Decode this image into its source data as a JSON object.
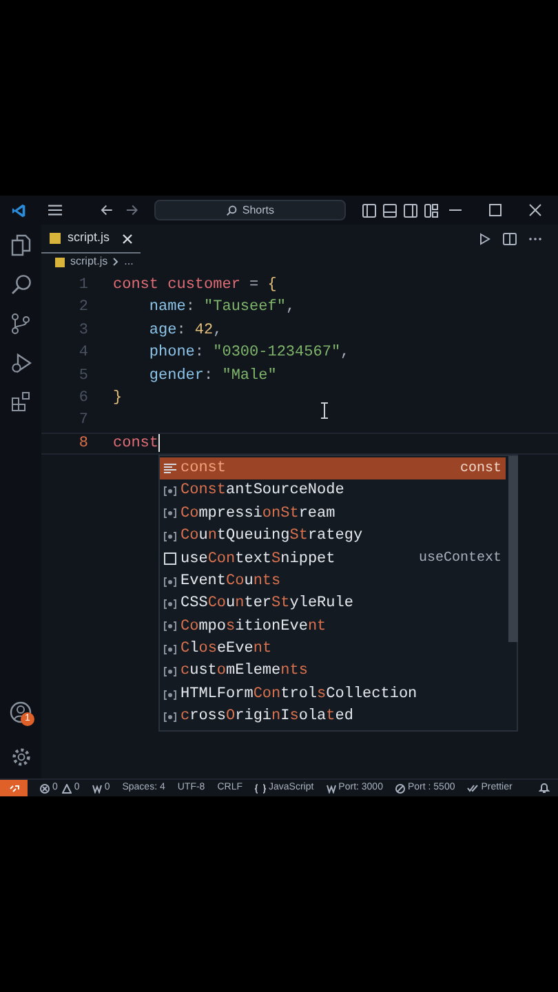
{
  "title_bar": {
    "search": "Shorts"
  },
  "tab": {
    "label": "script.js",
    "selected": true
  },
  "breadcrumb": {
    "file": "script.js",
    "rest": "..."
  },
  "editor": {
    "lines": [
      {
        "number": "1",
        "current": false,
        "tokens": [
          {
            "kind": "keyword",
            "text": "const"
          },
          {
            "kind": "variable",
            "text": " customer"
          },
          {
            "kind": "plain",
            "text": " = "
          },
          {
            "kind": "brace",
            "text": "{"
          }
        ]
      },
      {
        "number": "2",
        "current": false,
        "tokens": [
          {
            "kind": "property",
            "text": "    name"
          },
          {
            "kind": "plain",
            "text": ": "
          },
          {
            "kind": "string",
            "text": "\"Tauseef\""
          },
          {
            "kind": "plain",
            "text": ","
          }
        ]
      },
      {
        "number": "3",
        "current": false,
        "tokens": [
          {
            "kind": "property",
            "text": "    age"
          },
          {
            "kind": "plain",
            "text": ": "
          },
          {
            "kind": "number",
            "text": "42"
          },
          {
            "kind": "plain",
            "text": ","
          }
        ]
      },
      {
        "number": "4",
        "current": false,
        "tokens": [
          {
            "kind": "property",
            "text": "    phone"
          },
          {
            "kind": "plain",
            "text": ": "
          },
          {
            "kind": "string",
            "text": "\"0300-1234567\""
          },
          {
            "kind": "plain",
            "text": ","
          }
        ]
      },
      {
        "number": "5",
        "current": false,
        "tokens": [
          {
            "kind": "property",
            "text": "    gender"
          },
          {
            "kind": "plain",
            "text": ": "
          },
          {
            "kind": "string",
            "text": "\"Male\""
          }
        ]
      },
      {
        "number": "6",
        "current": false,
        "tokens": [
          {
            "kind": "brace",
            "text": "}"
          }
        ]
      },
      {
        "number": "7",
        "current": false
      },
      {
        "number": "8",
        "current": true,
        "tokens": [
          {
            "kind": "keyword",
            "text": "const"
          }
        ]
      }
    ]
  },
  "suggestions": [
    {
      "kind": "keyword",
      "selected": true,
      "parts": [
        {
          "text": "const",
          "match": true
        }
      ],
      "detail": "const"
    },
    {
      "kind": "variable",
      "selected": false,
      "parts": [
        {
          "text": "Const",
          "match": true
        },
        {
          "text": "antSourceNode",
          "match": false
        }
      ]
    },
    {
      "kind": "variable",
      "selected": false,
      "parts": [
        {
          "text": "Co",
          "match": true
        },
        {
          "text": "mpressi",
          "match": false
        },
        {
          "text": "onSt",
          "match": true
        },
        {
          "text": "ream",
          "match": false
        }
      ]
    },
    {
      "kind": "variable",
      "selected": false,
      "parts": [
        {
          "text": "Co",
          "match": true
        },
        {
          "text": "u",
          "match": false
        },
        {
          "text": "n",
          "match": true
        },
        {
          "text": "tQueuing",
          "match": false
        },
        {
          "text": "St",
          "match": true
        },
        {
          "text": "rategy",
          "match": false
        }
      ]
    },
    {
      "kind": "snippet",
      "selected": false,
      "parts": [
        {
          "text": "use",
          "match": false
        },
        {
          "text": "Con",
          "match": true
        },
        {
          "text": "text",
          "match": false
        },
        {
          "text": "S",
          "match": true
        },
        {
          "text": "nippet",
          "match": false
        }
      ],
      "detail": "useContext"
    },
    {
      "kind": "variable",
      "selected": false,
      "parts": [
        {
          "text": "Event",
          "match": false
        },
        {
          "text": "Co",
          "match": true
        },
        {
          "text": "u",
          "match": false
        },
        {
          "text": "nts",
          "match": true
        }
      ]
    },
    {
      "kind": "variable",
      "selected": false,
      "parts": [
        {
          "text": "CSS",
          "match": false
        },
        {
          "text": "Co",
          "match": true
        },
        {
          "text": "u",
          "match": false
        },
        {
          "text": "n",
          "match": true
        },
        {
          "text": "ter",
          "match": false
        },
        {
          "text": "St",
          "match": true
        },
        {
          "text": "yleRule",
          "match": false
        }
      ]
    },
    {
      "kind": "variable",
      "selected": false,
      "parts": [
        {
          "text": "Co",
          "match": true
        },
        {
          "text": "mpo",
          "match": false
        },
        {
          "text": "s",
          "match": true
        },
        {
          "text": "itionEve",
          "match": false
        },
        {
          "text": "nt",
          "match": true
        }
      ]
    },
    {
      "kind": "variable",
      "selected": false,
      "parts": [
        {
          "text": "C",
          "match": true
        },
        {
          "text": "l",
          "match": false
        },
        {
          "text": "o",
          "match": true
        },
        {
          "text": "s",
          "match": true
        },
        {
          "text": "eEve",
          "match": false
        },
        {
          "text": "nt",
          "match": true
        }
      ]
    },
    {
      "kind": "variable",
      "selected": false,
      "parts": [
        {
          "text": "c",
          "match": true
        },
        {
          "text": "ust",
          "match": false
        },
        {
          "text": "o",
          "match": true
        },
        {
          "text": "mEleme",
          "match": false
        },
        {
          "text": "nts",
          "match": true
        }
      ]
    },
    {
      "kind": "variable",
      "selected": false,
      "parts": [
        {
          "text": "HTMLForm",
          "match": false
        },
        {
          "text": "Con",
          "match": true
        },
        {
          "text": "trol",
          "match": false
        },
        {
          "text": "s",
          "match": true
        },
        {
          "text": "Collection",
          "match": false
        }
      ]
    },
    {
      "kind": "variable",
      "selected": false,
      "parts": [
        {
          "text": "c",
          "match": true
        },
        {
          "text": "ross",
          "match": false
        },
        {
          "text": "O",
          "match": true
        },
        {
          "text": "rigi",
          "match": false
        },
        {
          "text": "n",
          "match": true
        },
        {
          "text": "I",
          "match": false
        },
        {
          "text": "s",
          "match": true
        },
        {
          "text": "ola",
          "match": false
        },
        {
          "text": "t",
          "match": true
        },
        {
          "text": "ed",
          "match": false
        }
      ]
    }
  ],
  "activity_bar": {
    "account_badge": "1"
  },
  "status_bar": [
    {
      "kind": "errors",
      "text": "0"
    },
    {
      "kind": "warnings",
      "text": "0"
    },
    {
      "kind": "ports",
      "text": "0"
    },
    {
      "kind": "plain",
      "text": "Spaces: 4"
    },
    {
      "kind": "plain",
      "text": "UTF-8"
    },
    {
      "kind": "plain",
      "text": "CRLF"
    },
    {
      "kind": "language",
      "text": "JavaScript"
    },
    {
      "kind": "ports",
      "text": "Port: 3000"
    },
    {
      "kind": "blocked",
      "text": "Port : 5500"
    },
    {
      "kind": "check",
      "text": "Prettier"
    },
    {
      "kind": "bell"
    }
  ]
}
